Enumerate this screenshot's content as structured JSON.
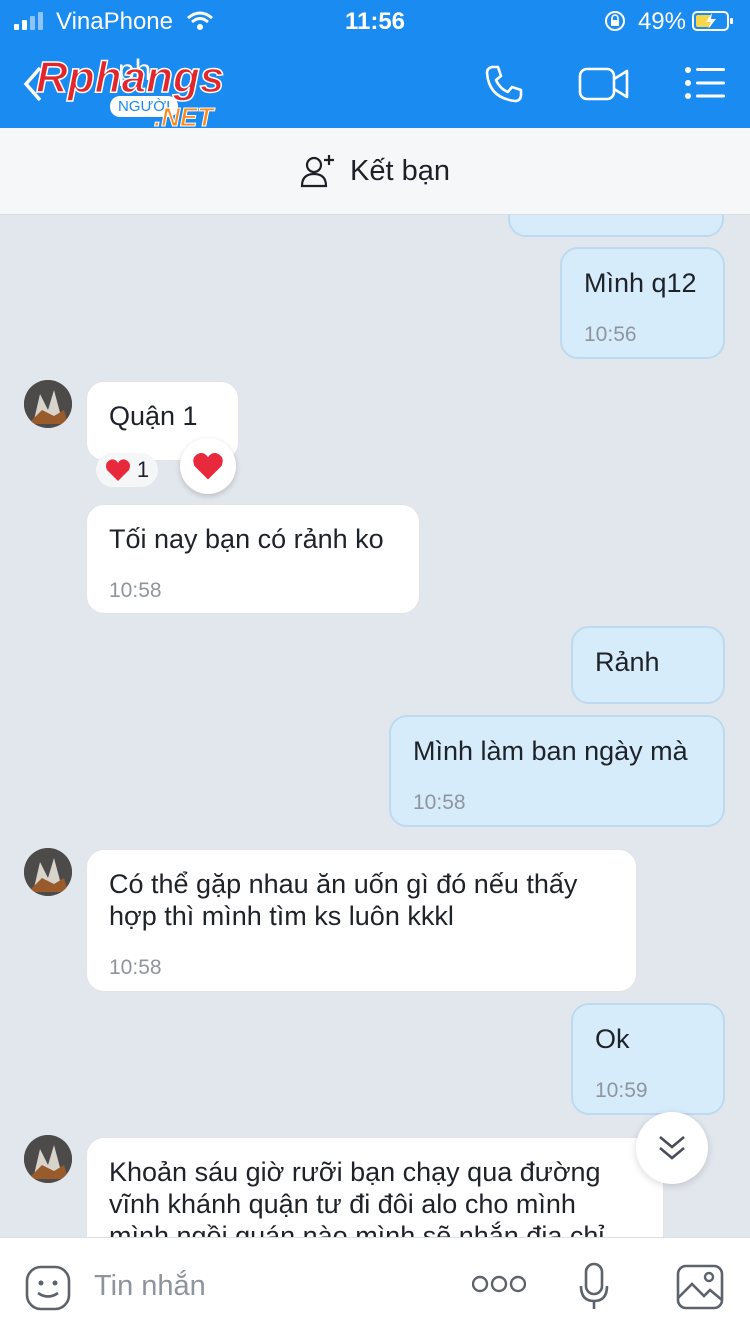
{
  "status_bar": {
    "carrier": "VinaPhone",
    "time": "11:56",
    "battery": "49%"
  },
  "header": {
    "contact_name": "ph",
    "contact_subtitle": "NGƯỜI",
    "watermark": {
      "line1": "Rphangs",
      "line2": ".NET"
    },
    "icons": [
      "back-icon",
      "phone-icon",
      "video-icon",
      "menu-icon"
    ]
  },
  "add_friend": {
    "label": "Kết bạn"
  },
  "messages": [
    {
      "from": "me",
      "text": "Mình q12",
      "time": "10:56"
    },
    {
      "from": "them",
      "text": "Quận 1",
      "time": ""
    },
    {
      "from": "them",
      "text": "Tối nay bạn có rảnh ko",
      "time": "10:58"
    },
    {
      "from": "me",
      "text": "Rảnh",
      "time": ""
    },
    {
      "from": "me",
      "text": "Mình làm ban ngày mà",
      "time": "10:58"
    },
    {
      "from": "them",
      "text": "Có thể gặp nhau ăn uốn gì đó nếu thấy hợp thì mình tìm ks luôn kkkl",
      "time": "10:58"
    },
    {
      "from": "me",
      "text": "Ok",
      "time": "10:59"
    },
    {
      "from": "them",
      "text": "Khoản sáu giờ rưỡi bạn chạy qua đường vĩnh khánh quận tư đi đôi alo cho mình mình ngồi quán nào mình sẽ nhắn địa chỉ",
      "time": ""
    }
  ],
  "reaction": {
    "count": "1",
    "emoji": "heart-icon"
  },
  "input": {
    "placeholder": "Tin nhắn"
  },
  "colors": {
    "header_blue": "#1a8bf0",
    "my_bubble": "#d6ecfb",
    "their_bubble": "#ffffff",
    "chat_bg": "#e2e6ed",
    "heart": "#e8293b"
  }
}
